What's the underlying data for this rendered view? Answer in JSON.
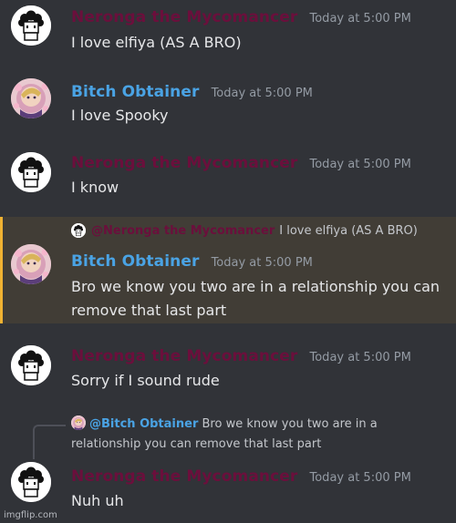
{
  "colors": {
    "neronga": "#6b0f3c",
    "bitch_obtainer": "#4aa3e4",
    "highlight_border": "#f0b232"
  },
  "messages": [
    {
      "author": "Neronga the Mycomancer",
      "timestamp": "Today at 5:00 PM",
      "text": "I love elfiya (AS A BRO)",
      "avatar": "neronga-avatar"
    },
    {
      "author": "Bitch Obtainer",
      "timestamp": "Today at 5:00 PM",
      "text": "I love Spooky",
      "avatar": "bitch-obtainer-avatar"
    },
    {
      "author": "Neronga the Mycomancer",
      "timestamp": "Today at 5:00 PM",
      "text": "I know",
      "avatar": "neronga-avatar"
    },
    {
      "reply_to": {
        "author": "@Neronga the Mycomancer",
        "text": "I love elfiya (AS A BRO)"
      },
      "author": "Bitch Obtainer",
      "timestamp": "Today at 5:00 PM",
      "text_line1": "Bro we know you two are in a relationship you can",
      "text_line2": "remove that last part",
      "avatar": "bitch-obtainer-avatar"
    },
    {
      "author": "Neronga the Mycomancer",
      "timestamp": "Today at 5:00 PM",
      "text": "Sorry if I sound rude",
      "avatar": "neronga-avatar"
    },
    {
      "reply_to": {
        "author": "@Bitch Obtainer",
        "text_line1": "Bro we know you two are in a",
        "text_line2": "relationship you can remove that last part"
      },
      "author": "Neronga the Mycomancer",
      "timestamp": "Today at 5:00 PM",
      "text": "Nuh uh",
      "avatar": "neronga-avatar"
    }
  ],
  "watermark": "imgflip.com"
}
